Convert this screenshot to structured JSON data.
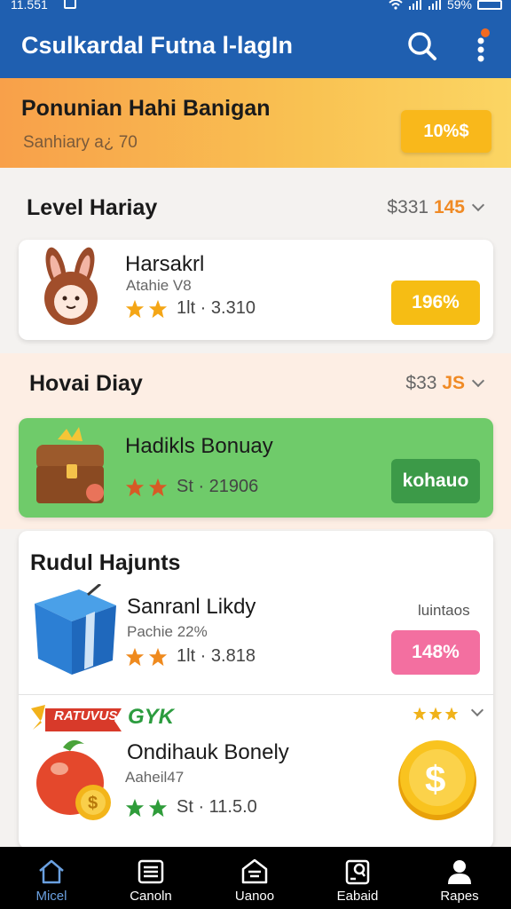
{
  "status_bar": {
    "time": "11.551",
    "battery": "59%"
  },
  "app_bar": {
    "title": "Csulkardal Futna l-lagIn"
  },
  "promo": {
    "title": "Ponunian Hahi Banigan",
    "subtitle": "Sanhiary a¿ 70",
    "badge": "10%$"
  },
  "sections": [
    {
      "title": "Level Hariay",
      "meta_prefix": "$331",
      "meta_accent": "145"
    },
    {
      "title": "Hovai Diay",
      "meta_prefix": "$33",
      "meta_accent": "JS"
    },
    {
      "title": "Rudul Hajunts"
    }
  ],
  "cards": [
    {
      "title": "Harsakrl",
      "subtitle": "Atahie V8",
      "rating": "1lt · 3.310",
      "button": "196%",
      "button_color": "#f6bd14",
      "icon": "bunny-icon"
    },
    {
      "title": "Hadikls Bonuay",
      "rating": "St · 21906",
      "button": "kohauo",
      "button_color": "#3c9a48",
      "icon": "treasure-chest-icon"
    },
    {
      "title": "Sanranl Likdy",
      "subtitle": "Pachie 22%",
      "side_label": "luintaos",
      "rating": "1lt · 3.818",
      "button": "148%",
      "button_color": "#f36fa0",
      "icon": "gift-box-icon"
    },
    {
      "ribbon": "RATUVUS",
      "tag": "GYK",
      "title": "Ondihauk Bonely",
      "subtitle": "Aaheil47",
      "rating": "St · 11.5.0",
      "icon": "fruit-coin-icon",
      "action_icon": "dollar-coin-icon"
    }
  ],
  "tabs": [
    {
      "label": "Micel",
      "icon": "home-icon",
      "active": true
    },
    {
      "label": "Canoln",
      "icon": "list-icon"
    },
    {
      "label": "Uanoo",
      "icon": "inbox-icon"
    },
    {
      "label": "Eabaid",
      "icon": "clipboard-icon"
    },
    {
      "label": "Rapes",
      "icon": "user-icon"
    }
  ],
  "colors": {
    "app_bar": "#1f5fb0",
    "accent_orange": "#f08a24",
    "green_card": "#6fcb6a"
  }
}
